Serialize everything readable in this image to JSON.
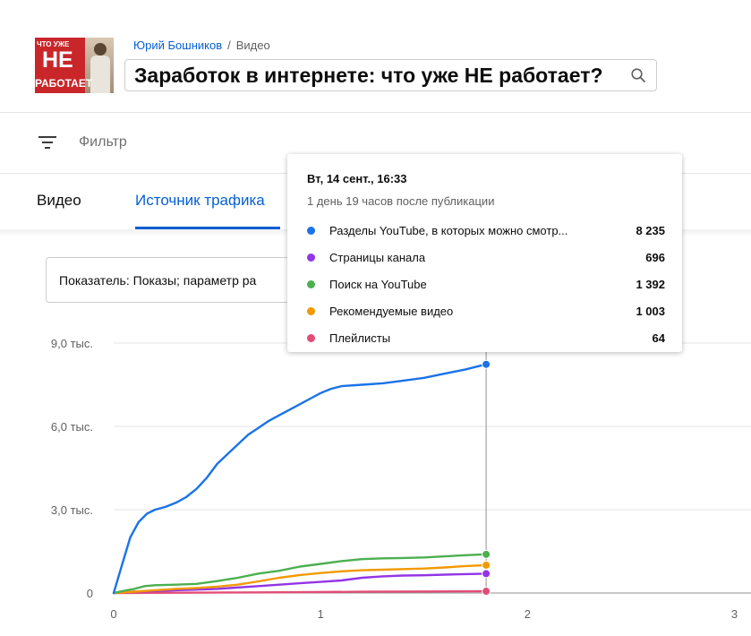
{
  "video": {
    "thumbnail": {
      "line1": "ЧТО УЖЕ",
      "line2": "НЕ",
      "line3": "РАБОТАЕТ"
    },
    "breadcrumb": {
      "channel": "Юрий Бошников",
      "separator": "/",
      "section": "Видео"
    },
    "title": "Заработок в интернете: что уже НЕ работает?",
    "title_icon": "search-icon"
  },
  "filter": {
    "icon": "filter-icon",
    "label": "Фильтр"
  },
  "tabs": [
    {
      "label": "Видео",
      "active": false
    },
    {
      "label": "Источник трафика",
      "active": true
    }
  ],
  "metric_select": {
    "value": "Показатель: Показы; параметр ра"
  },
  "tooltip": {
    "title": "Вт, 14 сент., 16:33",
    "subtitle": "1 день 19 часов после публикации",
    "rows": [
      {
        "name": "Разделы YouTube, в которых можно смотр...",
        "value": "8 235",
        "color": "#1a73e8"
      },
      {
        "name": "Страницы канала",
        "value": "696",
        "color": "#9334e6"
      },
      {
        "name": "Поиск на YouTube",
        "value": "1 392",
        "color": "#4caf50"
      },
      {
        "name": "Рекомендуемые видео",
        "value": "1 003",
        "color": "#f29900"
      },
      {
        "name": "Плейлисты",
        "value": "64",
        "color": "#e24d77"
      }
    ]
  },
  "chart_data": {
    "type": "line",
    "x_ticks": [
      "0",
      "1",
      "2",
      "3"
    ],
    "y_ticks": [
      "0",
      "3,0 тыс.",
      "6,0 тыс.",
      "9,0 тыс."
    ],
    "x_range": [
      0,
      3.08
    ],
    "y_range": [
      0,
      9000
    ],
    "hover_x": 1.8,
    "grid": true,
    "series": [
      {
        "name": "Разделы YouTube, в которых можно смотр...",
        "color": "#1a73e8",
        "points": [
          [
            0,
            0
          ],
          [
            0.04,
            1000
          ],
          [
            0.08,
            2000
          ],
          [
            0.12,
            2550
          ],
          [
            0.16,
            2850
          ],
          [
            0.2,
            3000
          ],
          [
            0.25,
            3100
          ],
          [
            0.3,
            3250
          ],
          [
            0.35,
            3450
          ],
          [
            0.4,
            3750
          ],
          [
            0.45,
            4150
          ],
          [
            0.5,
            4650
          ],
          [
            0.55,
            5000
          ],
          [
            0.6,
            5350
          ],
          [
            0.65,
            5700
          ],
          [
            0.7,
            5950
          ],
          [
            0.75,
            6200
          ],
          [
            0.8,
            6400
          ],
          [
            0.85,
            6600
          ],
          [
            0.9,
            6800
          ],
          [
            0.95,
            7000
          ],
          [
            1.0,
            7200
          ],
          [
            1.05,
            7350
          ],
          [
            1.1,
            7450
          ],
          [
            1.2,
            7500
          ],
          [
            1.3,
            7550
          ],
          [
            1.4,
            7650
          ],
          [
            1.5,
            7750
          ],
          [
            1.6,
            7900
          ],
          [
            1.7,
            8050
          ],
          [
            1.8,
            8235
          ]
        ]
      },
      {
        "name": "Страницы канала",
        "color": "#9334e6",
        "points": [
          [
            0,
            0
          ],
          [
            0.1,
            50
          ],
          [
            0.3,
            100
          ],
          [
            0.5,
            150
          ],
          [
            0.7,
            250
          ],
          [
            0.9,
            350
          ],
          [
            1.0,
            400
          ],
          [
            1.1,
            450
          ],
          [
            1.2,
            550
          ],
          [
            1.3,
            600
          ],
          [
            1.4,
            630
          ],
          [
            1.5,
            640
          ],
          [
            1.6,
            660
          ],
          [
            1.7,
            680
          ],
          [
            1.8,
            696
          ]
        ]
      },
      {
        "name": "Поиск на YouTube",
        "color": "#4caf50",
        "points": [
          [
            0,
            0
          ],
          [
            0.05,
            80
          ],
          [
            0.1,
            150
          ],
          [
            0.15,
            250
          ],
          [
            0.2,
            280
          ],
          [
            0.3,
            300
          ],
          [
            0.4,
            330
          ],
          [
            0.5,
            430
          ],
          [
            0.6,
            550
          ],
          [
            0.7,
            700
          ],
          [
            0.8,
            800
          ],
          [
            0.9,
            950
          ],
          [
            1.0,
            1050
          ],
          [
            1.1,
            1150
          ],
          [
            1.2,
            1220
          ],
          [
            1.3,
            1250
          ],
          [
            1.4,
            1260
          ],
          [
            1.5,
            1280
          ],
          [
            1.6,
            1320
          ],
          [
            1.7,
            1360
          ],
          [
            1.8,
            1392
          ]
        ]
      },
      {
        "name": "Рекомендуемые видео",
        "color": "#f29900",
        "points": [
          [
            0,
            0
          ],
          [
            0.1,
            50
          ],
          [
            0.2,
            100
          ],
          [
            0.3,
            150
          ],
          [
            0.4,
            180
          ],
          [
            0.5,
            230
          ],
          [
            0.6,
            300
          ],
          [
            0.7,
            420
          ],
          [
            0.8,
            550
          ],
          [
            0.9,
            650
          ],
          [
            1.0,
            720
          ],
          [
            1.1,
            780
          ],
          [
            1.2,
            820
          ],
          [
            1.3,
            840
          ],
          [
            1.4,
            860
          ],
          [
            1.5,
            880
          ],
          [
            1.6,
            920
          ],
          [
            1.7,
            970
          ],
          [
            1.8,
            1003
          ]
        ]
      },
      {
        "name": "Плейлисты",
        "color": "#e24d77",
        "points": [
          [
            0,
            0
          ],
          [
            0.3,
            10
          ],
          [
            0.6,
            20
          ],
          [
            0.9,
            30
          ],
          [
            1.2,
            45
          ],
          [
            1.5,
            55
          ],
          [
            1.8,
            64
          ]
        ]
      }
    ]
  }
}
